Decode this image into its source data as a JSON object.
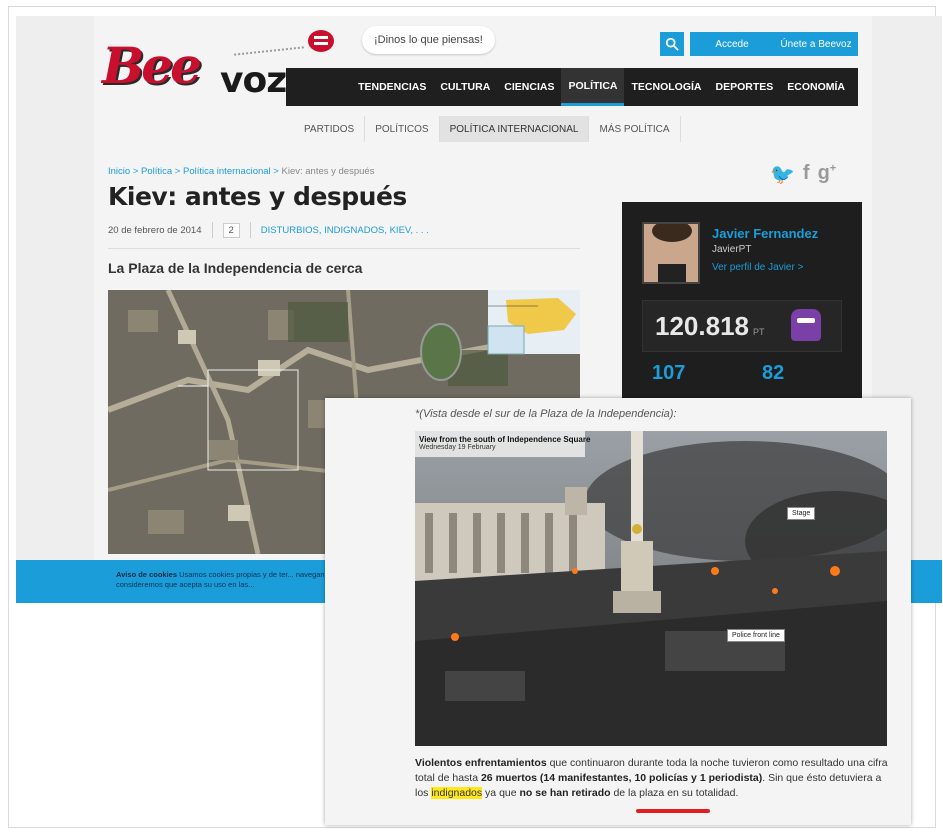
{
  "site": {
    "speech_bubble": "¡Dinos lo que piensas!",
    "login_label": "Accede",
    "join_label": "Únete a Beevoz",
    "nav": [
      "TENDENCIAS",
      "CULTURA",
      "CIENCIAS",
      "POLÍTICA",
      "TECNOLOGÍA",
      "DEPORTES",
      "ECONOMÍA"
    ],
    "nav_active": "POLÍTICA",
    "subnav": [
      "PARTIDOS",
      "POLÍTICOS",
      "POLÍTICA INTERNACIONAL",
      "MÁS POLÍTICA"
    ],
    "subnav_active": "POLÍTICA INTERNACIONAL",
    "accent": "#1b9dd9",
    "brand_red": "#c8102e"
  },
  "article": {
    "breadcrumb": {
      "inicio": "Inicio",
      "politica": "Política",
      "internacional": "Política internacional",
      "current": "Kiev: antes y después",
      "sep": " > "
    },
    "title": "Kiev: antes y después",
    "date": "20 de febrero de 2014",
    "comments": "2",
    "tags": "DISTURBIOS, INDIGNADOS, KIEV, . . .",
    "subtitle": "La Plaza de la Independencia de cerca",
    "map_labels": {
      "protest": "Protest camp",
      "kiev": "Kiev",
      "ukraine": "UKRAINE"
    }
  },
  "social": {
    "twitter": "twitter-icon",
    "facebook": "facebook-icon",
    "gplus": "gplus-icon"
  },
  "profile": {
    "name": "Javier Fernandez",
    "handle": "JavierPT",
    "link": "Ver perfil de Javier >",
    "points": "120.818",
    "points_unit": "PT",
    "stat_a": "107",
    "stat_b": "82"
  },
  "cookie": {
    "title": "Aviso de cookies",
    "text": "Usamos cookies propias y de ter... navegando consideremos que acepta su uso en las..."
  },
  "overlay": {
    "quote": "*(Vista desde el sur de la Plaza de la Independencia):",
    "photo_title": "View from the south of Independence Square",
    "photo_sub": "Wednesday 19 February",
    "callout_stage": "Stage",
    "callout_police": "Police front line",
    "body_bold1": "Violentos enfrentamientos",
    "body_1": " que continuaron durante toda la noche tuvieron como resultado una cifra total de hasta ",
    "body_bold2": "26 muertos (14 manifestantes, 10 policías y 1 periodista)",
    "body_2": ". Sin que ésto detuviera a los ",
    "body_hl": "indignados",
    "body_3": " ya que ",
    "body_bold3": "no se han retirado",
    "body_4": " de la plaza en su totalidad."
  }
}
